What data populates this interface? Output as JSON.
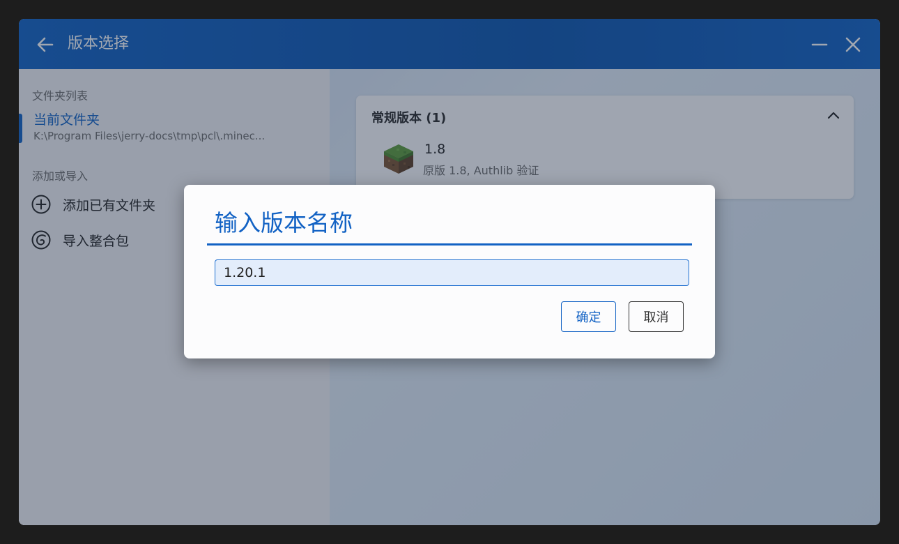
{
  "window": {
    "title": "版本选择"
  },
  "sidebar": {
    "folder_list_label": "文件夹列表",
    "current_folder": {
      "title": "当前文件夹",
      "path": "K:\\Program Files\\jerry-docs\\tmp\\pcl\\.minec..."
    },
    "add_or_import_label": "添加或导入",
    "actions": [
      {
        "label": "添加已有文件夹",
        "icon": "plus-circle-icon"
      },
      {
        "label": "导入整合包",
        "icon": "import-package-icon"
      }
    ]
  },
  "main": {
    "group": {
      "title": "常规版本 (1)",
      "expanded": true
    },
    "versions": [
      {
        "name": "1.8",
        "description": "原版 1.8, Authlib 验证",
        "icon": "grass-block-icon"
      }
    ]
  },
  "dialog": {
    "title": "输入版本名称",
    "input_value": "1.20.1",
    "confirm_label": "确定",
    "cancel_label": "取消"
  },
  "colors": {
    "accent": "#1262c4",
    "titlebar": "#0d55ad",
    "input_bg": "#e3edfb"
  }
}
